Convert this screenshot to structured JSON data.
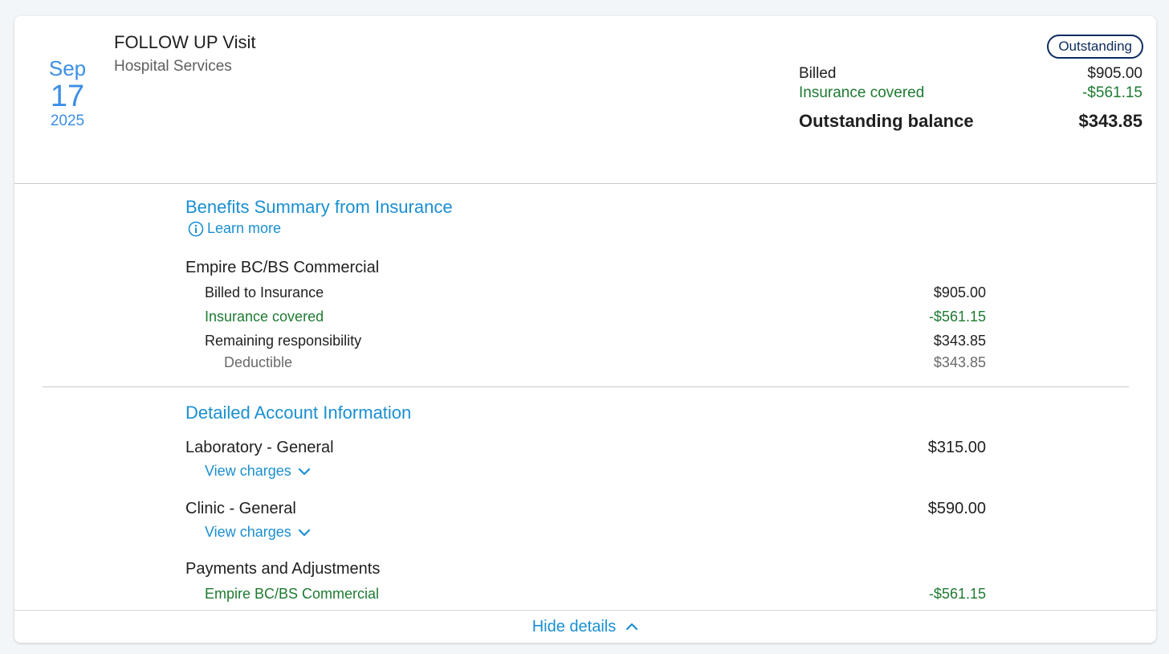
{
  "visit": {
    "month": "Sep",
    "day": "17",
    "year": "2025",
    "title": "FOLLOW UP Visit",
    "subtitle": "Hospital Services",
    "status": "Outstanding"
  },
  "summary": {
    "billed_label": "Billed",
    "billed_value": "$905.00",
    "insurance_label": "Insurance covered",
    "insurance_value": "-$561.15",
    "balance_label": "Outstanding balance",
    "balance_value": "$343.85"
  },
  "benefits": {
    "title": "Benefits Summary from Insurance",
    "learn_more": "Learn more",
    "plan": "Empire BC/BS Commercial",
    "rows": [
      {
        "label": "Billed to Insurance",
        "value": "$905.00"
      },
      {
        "label": "Insurance covered",
        "value": "-$561.15"
      },
      {
        "label": "Remaining responsibility",
        "value": "$343.85"
      },
      {
        "label": "Deductible",
        "value": "$343.85"
      }
    ]
  },
  "account": {
    "title": "Detailed Account Information",
    "items": [
      {
        "label": "Laboratory - General",
        "value": "$315.00",
        "action": "View charges"
      },
      {
        "label": "Clinic - General",
        "value": "$590.00",
        "action": "View charges"
      }
    ],
    "payments_title": "Payments and Adjustments",
    "payments": [
      {
        "label": "Empire BC/BS Commercial",
        "value": "-$561.15"
      }
    ]
  },
  "footer": {
    "hide_details": "Hide details"
  },
  "colors": {
    "accent": "#1a8fd1",
    "date": "#3b8fe4",
    "green": "#1e7a32",
    "badge_border": "#0d2b5e"
  }
}
